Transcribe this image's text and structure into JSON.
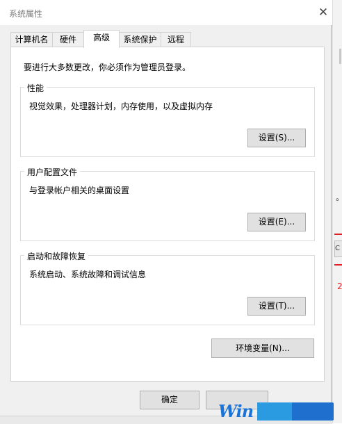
{
  "window": {
    "title": "系统属性"
  },
  "tabs": [
    {
      "label": "计算机名",
      "active": false
    },
    {
      "label": "硬件",
      "active": false
    },
    {
      "label": "高级",
      "active": true
    },
    {
      "label": "系统保护",
      "active": false
    },
    {
      "label": "远程",
      "active": false
    }
  ],
  "notice": "要进行大多数更改，你必须作为管理员登录。",
  "groups": {
    "performance": {
      "legend": "性能",
      "description": "视觉效果，处理器计划，内存使用，以及虚拟内存",
      "button": "设置(S)..."
    },
    "user_profiles": {
      "legend": "用户配置文件",
      "description": "与登录帐户相关的桌面设置",
      "button": "设置(E)..."
    },
    "startup_recovery": {
      "legend": "启动和故障恢复",
      "description": "系统启动、系统故障和调试信息",
      "button": "设置(T)..."
    }
  },
  "env_button": "环境变量(N)...",
  "footer": {
    "ok_label": "确定",
    "cancel_label": ""
  },
  "background": {
    "dot": "。",
    "box_text": "C",
    "red_mark": "2"
  },
  "watermark": {
    "text": "Win"
  },
  "icons": {
    "close": "close-icon"
  }
}
